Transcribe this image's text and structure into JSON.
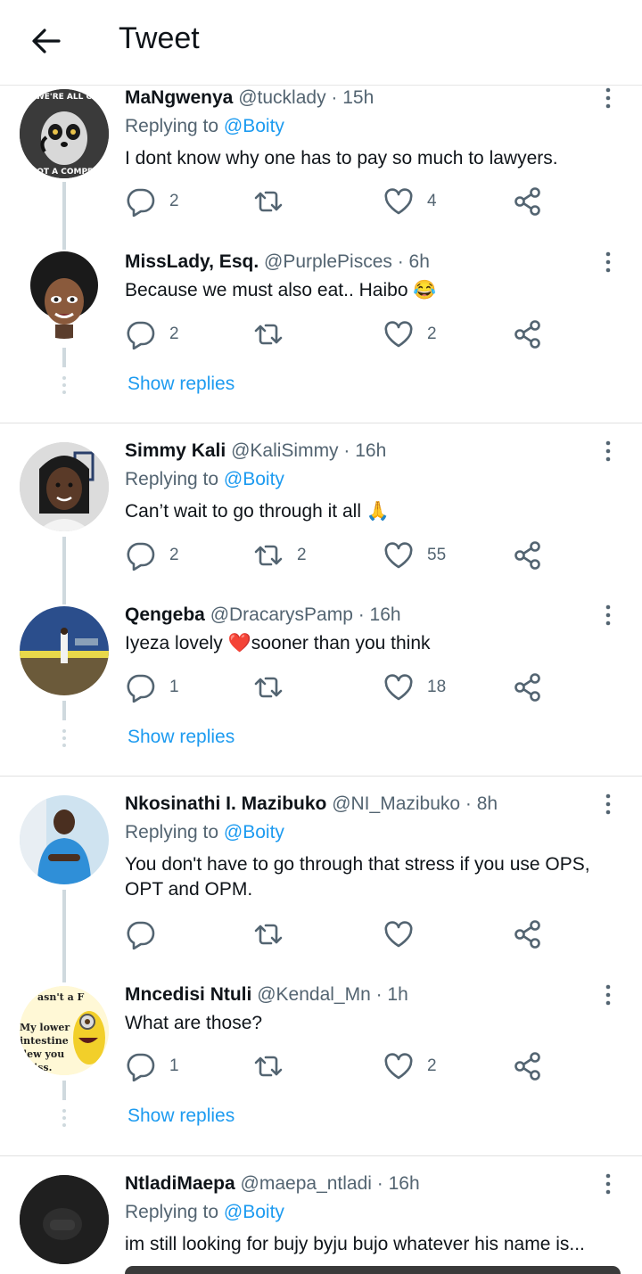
{
  "header": {
    "title": "Tweet"
  },
  "show_replies_label": "Show replies",
  "tweets": [
    {
      "name": "MaNgwenya",
      "handle": "@tucklady",
      "time": " · 15h",
      "replying_prefix": "Replying to ",
      "replying_to": "@Boity",
      "text": "I dont know why one has to pay so much to lawyers.",
      "replies": "2",
      "retweets": "",
      "likes": "4",
      "avatar_text_top": "WE'RE ALL O",
      "avatar_text_bottom": "NOT A COMPET"
    },
    {
      "name": "MissLady, Esq.",
      "handle": "@PurplePisces",
      "time": " · 6h",
      "text": "Because we must also eat.. Haibo",
      "emoji": "😂",
      "replies": "2",
      "retweets": "",
      "likes": "2"
    },
    {
      "name": "Simmy Kali",
      "handle": "@KaliSimmy",
      "time": " · 16h",
      "replying_prefix": "Replying to ",
      "replying_to": "@Boity",
      "text": "Can’t wait to go through it all",
      "emoji": "🙏",
      "replies": "2",
      "retweets": "2",
      "likes": "55"
    },
    {
      "name": "Qengeba",
      "handle": "@DracarysPamp",
      "time": " · 16h",
      "text_a": "Iyeza lovely ",
      "emoji": "❤️",
      "text_b": "sooner than you think",
      "replies": "1",
      "retweets": "",
      "likes": "18"
    },
    {
      "name": "Nkosinathi I. Mazibuko",
      "handle": "@NI_Mazibuko",
      "time": " · 8h",
      "replying_prefix": "Replying to ",
      "replying_to": "@Boity",
      "text": "You don't have to go through that stress if you use OPS, OPT and OPM.",
      "replies": "",
      "retweets": "",
      "likes": ""
    },
    {
      "name": "Mncedisi Ntuli",
      "handle": "@Kendal_Mn",
      "time": " · 1h",
      "text": "What are those?",
      "replies": "1",
      "retweets": "",
      "likes": "2",
      "avatar_lines": [
        "asn't a F",
        "My lower",
        "intestine",
        "lew you",
        "iss."
      ]
    },
    {
      "name": "NtladiMaepa",
      "handle": "@maepa_ntladi",
      "time": " · 16h",
      "replying_prefix": "Replying to ",
      "replying_to": "@Boity",
      "text": "im still looking for bujy byju bujo whatever his name is..."
    }
  ],
  "colors": {
    "accent": "#1d9bf0",
    "secondary": "#536471",
    "thread_line": "#cfd9de",
    "divider": "#e1e1e1"
  }
}
